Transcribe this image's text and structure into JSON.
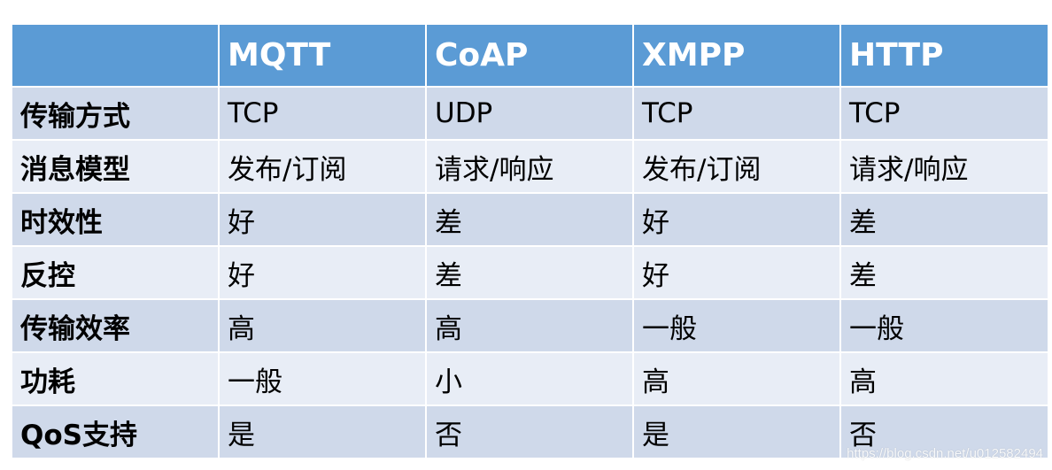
{
  "table": {
    "corner": "",
    "headers": [
      "MQTT",
      "CoAP",
      "XMPP",
      "HTTP"
    ],
    "rows": [
      {
        "label": "传输方式",
        "cells": [
          "TCP",
          "UDP",
          "TCP",
          "TCP"
        ]
      },
      {
        "label": "消息模型",
        "cells": [
          "发布/订阅",
          "请求/响应",
          "发布/订阅",
          "请求/响应"
        ]
      },
      {
        "label": "时效性",
        "cells": [
          "好",
          "差",
          "好",
          "差"
        ]
      },
      {
        "label": "反控",
        "cells": [
          "好",
          "差",
          "好",
          "差"
        ]
      },
      {
        "label": "传输效率",
        "cells": [
          "高",
          "高",
          "一般",
          "一般"
        ]
      },
      {
        "label": "功耗",
        "cells": [
          "一般",
          "小",
          "高",
          "高"
        ]
      },
      {
        "label": "QoS支持",
        "cells": [
          "是",
          "否",
          "是",
          "否"
        ]
      }
    ]
  },
  "colors": {
    "header_bg": "#5b9bd5",
    "row_odd_bg": "#cfd9ea",
    "row_even_bg": "#e8edf6",
    "border": "#ffffff"
  },
  "watermark": "https://blog.csdn.net/u012582494"
}
